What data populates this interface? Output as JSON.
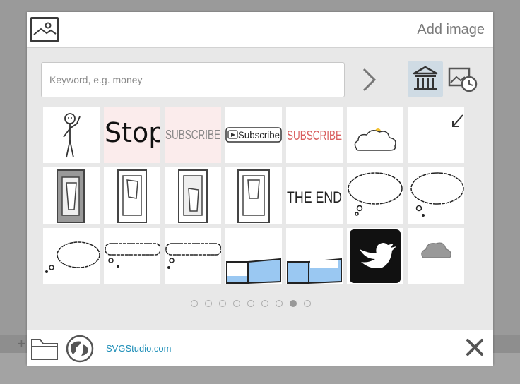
{
  "dialog": {
    "title": "Add image"
  },
  "search": {
    "placeholder": "Keyword, e.g. money",
    "value": ""
  },
  "tiles": {
    "stop": "Stop",
    "subscribe_gray": "SUBSCRIBE",
    "subscribe_button": "Subscribe",
    "subscribe_red": "SUBSCRIBE",
    "the_end": "THE END"
  },
  "pagination": {
    "pages": 9,
    "current": 8
  },
  "footer": {
    "site_link": "SVGStudio.com"
  },
  "colors": {
    "accent_link": "#1a8cb6",
    "selected_tab": "#cfdbe4",
    "water": "#9ac8f2"
  }
}
